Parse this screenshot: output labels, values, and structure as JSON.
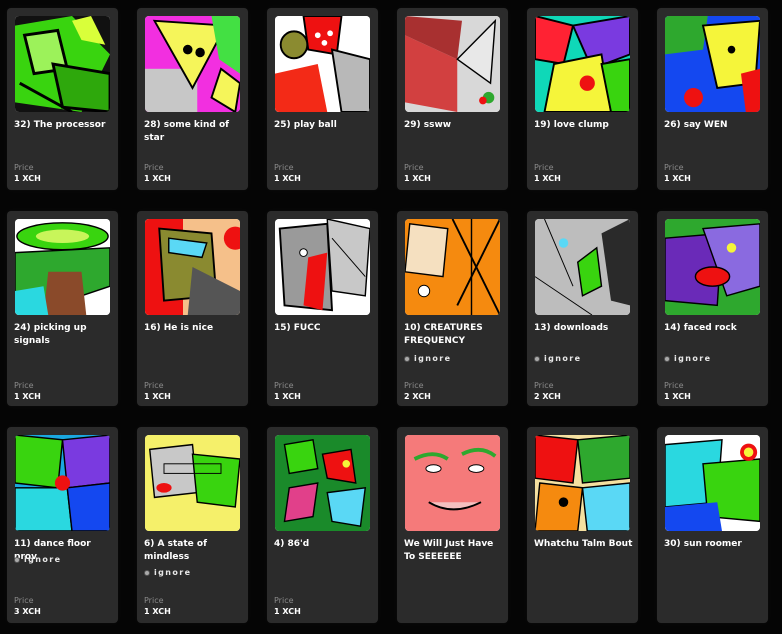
{
  "labels": {
    "price": "Price"
  },
  "items": [
    {
      "title": "32) The processor",
      "price": "1 XCH",
      "creator": ""
    },
    {
      "title": "28) some kind of star",
      "price": "1 XCH",
      "creator": ""
    },
    {
      "title": "25) play ball",
      "price": "1 XCH",
      "creator": ""
    },
    {
      "title": "29) ssww",
      "price": "1 XCH",
      "creator": ""
    },
    {
      "title": "19) love clump",
      "price": "1 XCH",
      "creator": ""
    },
    {
      "title": "26) say WEN",
      "price": "1 XCH",
      "creator": ""
    },
    {
      "title": "24) picking up signals",
      "price": "1 XCH",
      "creator": ""
    },
    {
      "title": "16) He is nice",
      "price": "1 XCH",
      "creator": ""
    },
    {
      "title": "15) FUCC",
      "price": "1 XCH",
      "creator": ""
    },
    {
      "title": "10) CREATURES FREQUENCY",
      "price": "2 XCH",
      "creator": "ignore"
    },
    {
      "title": "13) downloads",
      "price": "2 XCH",
      "creator": "ignore"
    },
    {
      "title": "14) faced rock",
      "price": "1 XCH",
      "creator": "ignore"
    },
    {
      "title": "11) dance floor prov",
      "price": "3 XCH",
      "creator": "ignore"
    },
    {
      "title": "6) A state of mindless",
      "price": "1 XCH",
      "creator": "ignore"
    },
    {
      "title": "4) 86'd",
      "price": "1 XCH",
      "creator": ""
    },
    {
      "title": "We Will Just Have To SEEEEEE",
      "price": "",
      "creator": ""
    },
    {
      "title": "Whatchu Talm Bout",
      "price": "",
      "creator": ""
    },
    {
      "title": "30) sun roomer",
      "price": "",
      "creator": ""
    }
  ]
}
